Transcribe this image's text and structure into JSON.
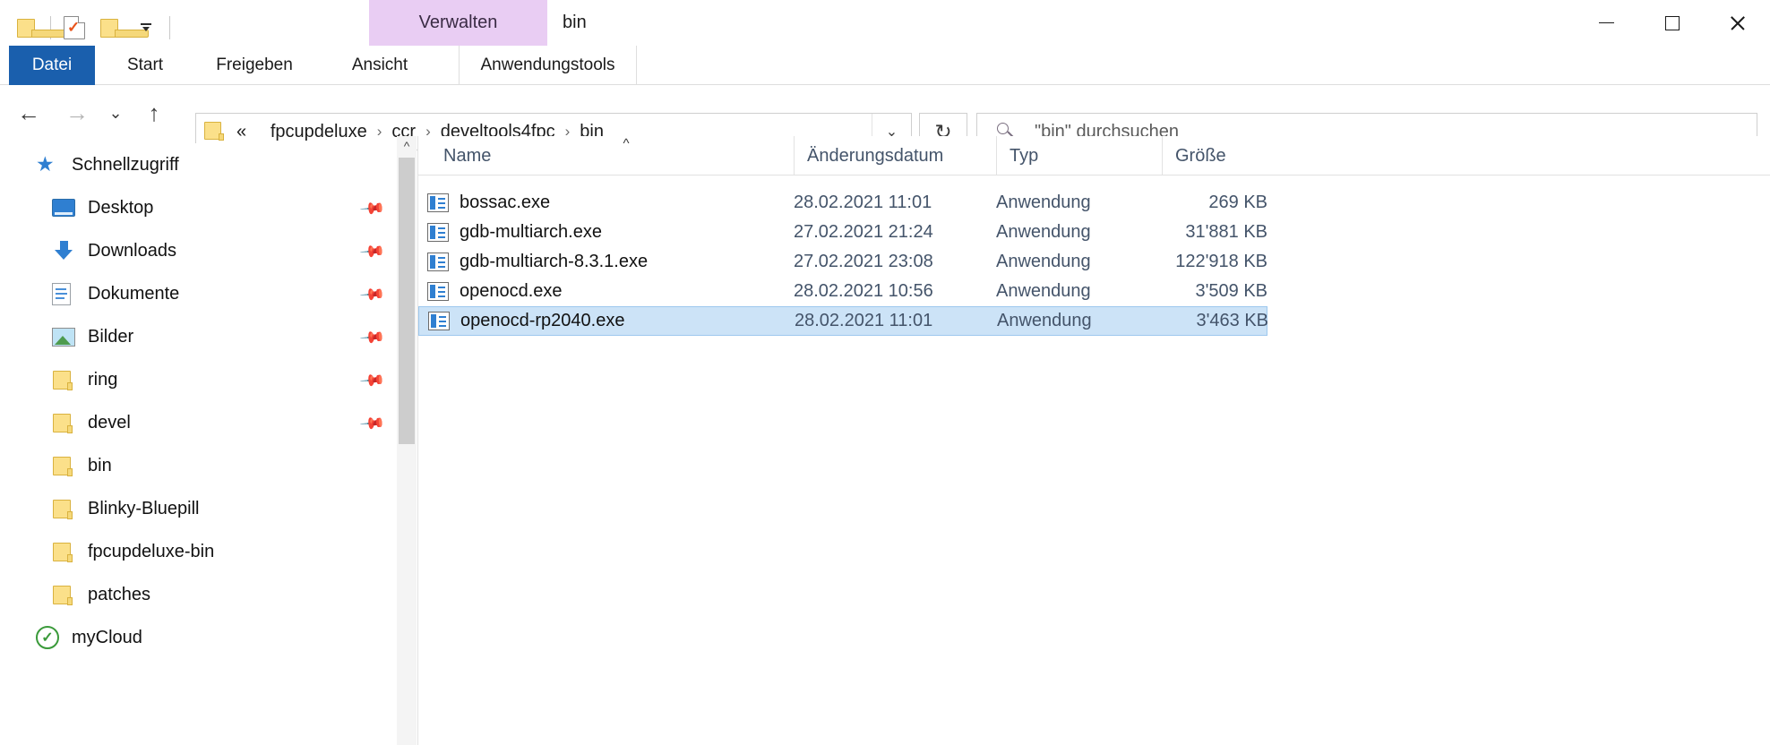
{
  "window": {
    "title": "bin",
    "contextual_tab_group": "Verwalten",
    "contextual_tab_color": "#e9cdf3",
    "minimize_label": "Minimieren",
    "maximize_label": "Maximieren",
    "close_label": "Schließen"
  },
  "quick_access": {
    "items": [
      {
        "name": "folder-icon",
        "label": "Ordner"
      },
      {
        "name": "properties-icon",
        "label": "Eigenschaften"
      },
      {
        "name": "new-folder-icon",
        "label": "Neuer Ordner"
      },
      {
        "name": "customize-dropdown-icon",
        "label": "Symbolleiste anpassen"
      }
    ]
  },
  "ribbon": {
    "tabs": [
      {
        "label": "Datei",
        "active": true,
        "contextual": false
      },
      {
        "label": "Start",
        "active": false,
        "contextual": false
      },
      {
        "label": "Freigeben",
        "active": false,
        "contextual": false
      },
      {
        "label": "Ansicht",
        "active": false,
        "contextual": false
      },
      {
        "label": "Anwendungstools",
        "active": false,
        "contextual": true
      }
    ],
    "collapse_icon": "chevron-down-icon",
    "help_label": "?"
  },
  "navigation": {
    "back_icon": "←",
    "forward_icon": "→",
    "recent_icon": "⌄",
    "up_icon": "↑",
    "breadcrumb": {
      "overflow": "«",
      "items": [
        "fpcupdeluxe",
        "ccr",
        "develtools4fpc",
        "bin"
      ],
      "separator": "›",
      "dropdown_icon": "⌄"
    },
    "refresh_icon": "↻"
  },
  "search": {
    "placeholder": "\"bin\" durchsuchen",
    "icon": "search-icon"
  },
  "sidebar": {
    "items": [
      {
        "label": "Schnellzugriff",
        "icon": "star-icon",
        "pinned": false,
        "indent": 0
      },
      {
        "label": "Desktop",
        "icon": "desktop-icon",
        "pinned": true,
        "indent": 1
      },
      {
        "label": "Downloads",
        "icon": "download-icon",
        "pinned": true,
        "indent": 1
      },
      {
        "label": "Dokumente",
        "icon": "document-icon",
        "pinned": true,
        "indent": 1
      },
      {
        "label": "Bilder",
        "icon": "pictures-icon",
        "pinned": true,
        "indent": 1
      },
      {
        "label": "ring",
        "icon": "folder-icon",
        "pinned": true,
        "indent": 1
      },
      {
        "label": "devel",
        "icon": "folder-icon",
        "pinned": true,
        "indent": 1
      },
      {
        "label": "bin",
        "icon": "folder-icon",
        "pinned": false,
        "indent": 1
      },
      {
        "label": "Blinky-Bluepill",
        "icon": "folder-icon",
        "pinned": false,
        "indent": 1
      },
      {
        "label": "fpcupdeluxe-bin",
        "icon": "folder-icon",
        "pinned": false,
        "indent": 1
      },
      {
        "label": "patches",
        "icon": "folder-icon",
        "pinned": false,
        "indent": 1
      },
      {
        "label": "myCloud",
        "icon": "cloud-check-icon",
        "pinned": false,
        "indent": 0
      }
    ]
  },
  "file_list": {
    "columns": [
      {
        "label": "Name",
        "sorted": true,
        "sort_direction": "asc"
      },
      {
        "label": "Änderungsdatum",
        "sorted": false,
        "sort_direction": ""
      },
      {
        "label": "Typ",
        "sorted": false,
        "sort_direction": ""
      },
      {
        "label": "Größe",
        "sorted": false,
        "sort_direction": ""
      }
    ],
    "sort_indicator": "^",
    "rows": [
      {
        "name": "bossac.exe",
        "date": "28.02.2021 11:01",
        "type": "Anwendung",
        "size": "269 KB",
        "icon": "exe-icon",
        "selected": false
      },
      {
        "name": "gdb-multiarch.exe",
        "date": "27.02.2021 21:24",
        "type": "Anwendung",
        "size": "31'881 KB",
        "icon": "exe-icon",
        "selected": false
      },
      {
        "name": "gdb-multiarch-8.3.1.exe",
        "date": "27.02.2021 23:08",
        "type": "Anwendung",
        "size": "122'918 KB",
        "icon": "exe-icon",
        "selected": false
      },
      {
        "name": "openocd.exe",
        "date": "28.02.2021 10:56",
        "type": "Anwendung",
        "size": "3'509 KB",
        "icon": "exe-icon",
        "selected": false
      },
      {
        "name": "openocd-rp2040.exe",
        "date": "28.02.2021 11:01",
        "type": "Anwendung",
        "size": "3'463 KB",
        "icon": "exe-icon",
        "selected": true
      }
    ]
  }
}
